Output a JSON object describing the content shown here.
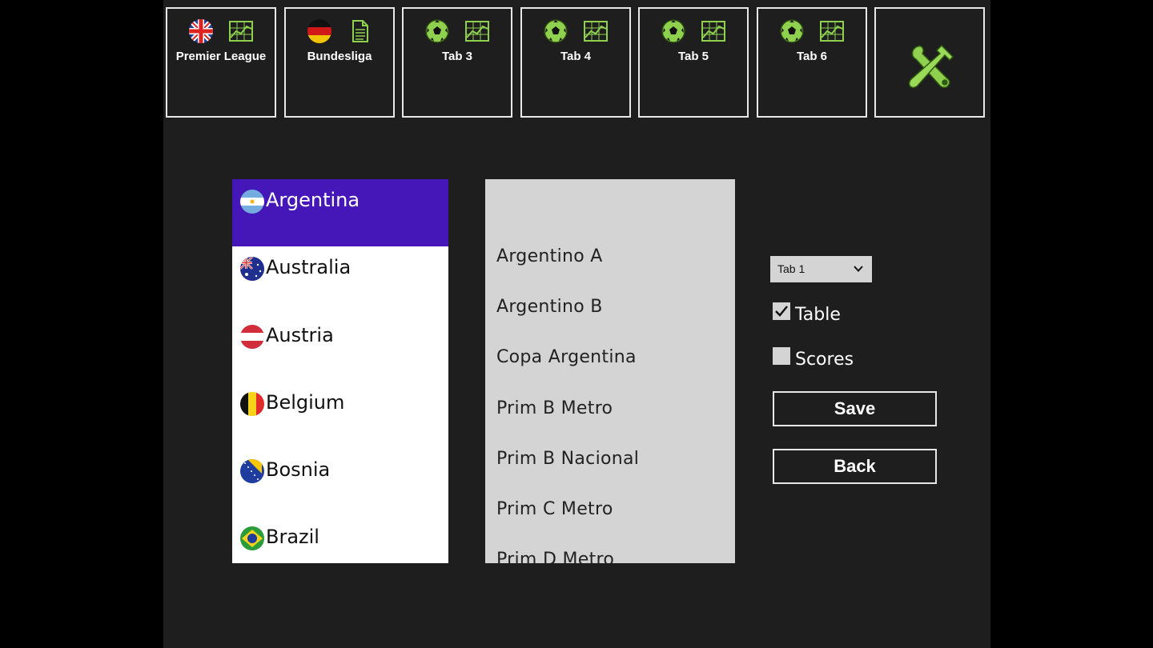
{
  "tabs": [
    {
      "label": "Premier League",
      "left_icon": "uk-flag-icon",
      "right_icon": "chart-icon"
    },
    {
      "label": "Bundesliga",
      "left_icon": "germany-flag-icon",
      "right_icon": "document-icon"
    },
    {
      "label": "Tab 3",
      "left_icon": "soccer-ball-icon",
      "right_icon": "chart-icon"
    },
    {
      "label": "Tab 4",
      "left_icon": "soccer-ball-icon",
      "right_icon": "chart-icon"
    },
    {
      "label": "Tab 5",
      "left_icon": "soccer-ball-icon",
      "right_icon": "chart-icon"
    },
    {
      "label": "Tab 6",
      "left_icon": "soccer-ball-icon",
      "right_icon": "chart-icon"
    }
  ],
  "settings_icon": "tools-icon",
  "countries": [
    {
      "name": "Argentina",
      "flag": "argentina-flag-icon",
      "selected": true
    },
    {
      "name": "Australia",
      "flag": "australia-flag-icon"
    },
    {
      "name": "Austria",
      "flag": "austria-flag-icon"
    },
    {
      "name": "Belgium",
      "flag": "belgium-flag-icon"
    },
    {
      "name": "Bosnia",
      "flag": "bosnia-flag-icon"
    },
    {
      "name": "Brazil",
      "flag": "brazil-flag-icon"
    }
  ],
  "leagues": [
    "Argentino A",
    "Argentino B",
    "Copa Argentina",
    "Prim B Metro",
    "Prim B Nacional",
    "Prim C Metro",
    "Prim D Metro"
  ],
  "tab_select": {
    "value": "Tab 1"
  },
  "options": {
    "table": {
      "label": "Table",
      "checked": true
    },
    "scores": {
      "label": "Scores",
      "checked": false
    }
  },
  "buttons": {
    "save": "Save",
    "back": "Back"
  },
  "colors": {
    "selected": "#4617b8",
    "icon_green": "#8fd14f",
    "panel": "#d4d4d4"
  }
}
